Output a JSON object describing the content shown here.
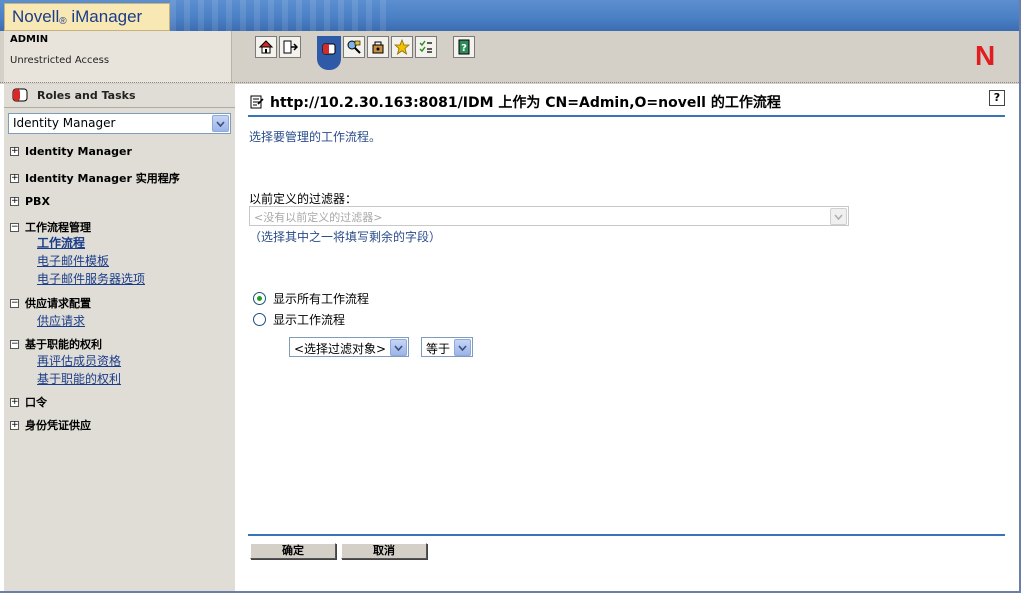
{
  "header": {
    "brand_name": "Novell",
    "brand_reg": "®",
    "brand_product": " iManager",
    "user": "ADMIN",
    "access": "Unrestricted Access",
    "logo_letter": "N",
    "toolbar_icons": [
      "home-icon",
      "exit-icon",
      "roles-tasks-icon",
      "view-objects-icon",
      "configure-icon",
      "favorites-icon",
      "preferences-icon",
      "help-book-icon"
    ]
  },
  "sidebar": {
    "title": "Roles and Tasks",
    "role_selected": "Identity Manager",
    "categories": [
      {
        "label": "Identity Manager",
        "expanded": false,
        "links": []
      },
      {
        "label": "Identity Manager 实用程序",
        "expanded": false,
        "links": []
      },
      {
        "label": "PBX",
        "expanded": false,
        "links": []
      },
      {
        "label": "工作流程管理",
        "expanded": true,
        "links": [
          "工作流程",
          "电子邮件模板",
          "电子邮件服务器选项"
        ]
      },
      {
        "label": "供应请求配置",
        "expanded": true,
        "links": [
          "供应请求"
        ]
      },
      {
        "label": "基于职能的权利",
        "expanded": true,
        "links": [
          "再评估成员资格",
          "基于职能的权利"
        ]
      },
      {
        "label": "口令",
        "expanded": false,
        "links": []
      },
      {
        "label": "身份凭证供应",
        "expanded": false,
        "links": []
      }
    ]
  },
  "main": {
    "title": "http://10.2.30.163:8081/IDM 上作为 CN=Admin,O=novell 的工作流程",
    "help": "?",
    "instruction": "选择要管理的工作流程。",
    "filter_label": "以前定义的过滤器：",
    "filter_placeholder": "<没有以前定义的过滤器>",
    "filter_hint": "（选择其中之一将填写剩余的字段）",
    "radio_all": "显示所有工作流程",
    "radio_filter": "显示工作流程",
    "object_select": "<选择过滤对象>",
    "operator_select": "等于",
    "ok": "确定",
    "cancel": "取消"
  },
  "colors": {
    "accent_blue": "#3a74b8",
    "link_blue": "#1a3d8a",
    "novell_red": "#e01e22",
    "sidebar_bg": "#e0ddd6"
  }
}
